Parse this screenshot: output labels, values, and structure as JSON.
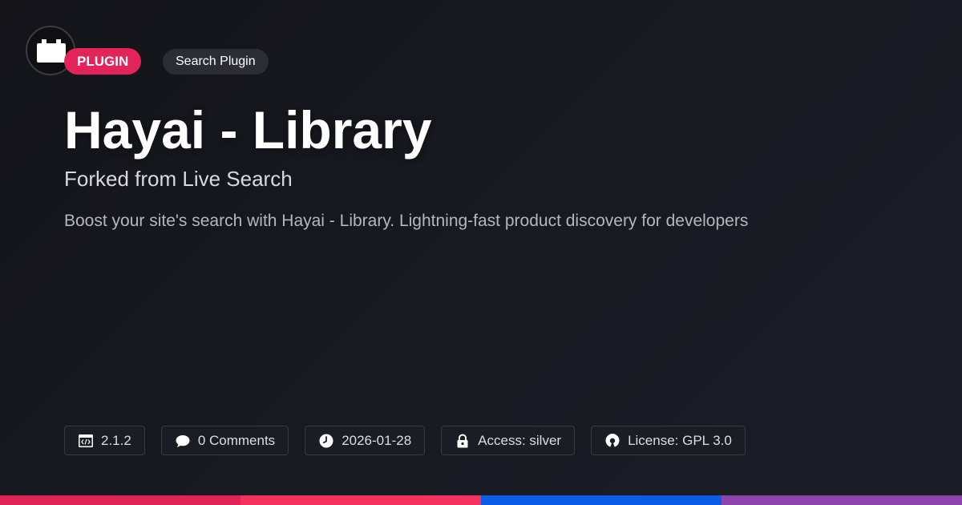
{
  "badge": {
    "label": "PLUGIN",
    "color": "#e3245a"
  },
  "category": {
    "label": "Search Plugin"
  },
  "title": "Hayai - Library",
  "subtitle": "Forked from Live Search",
  "description": "Boost your site's search with Hayai - Library. Lightning-fast product discovery for developers",
  "logo": {
    "icon": "plugin-block-icon"
  },
  "meta": [
    {
      "icon": "code-icon",
      "label": "2.1.2"
    },
    {
      "icon": "comment-icon",
      "label": "0 Comments"
    },
    {
      "icon": "clock-icon",
      "label": "2026-01-28"
    },
    {
      "icon": "lock-icon",
      "label": "Access: silver"
    },
    {
      "icon": "open-source-icon",
      "label": "License: GPL 3.0"
    }
  ],
  "accent_colors": [
    "#e0245a",
    "#f5325f",
    "#0a5ce6",
    "#8e44ad"
  ]
}
